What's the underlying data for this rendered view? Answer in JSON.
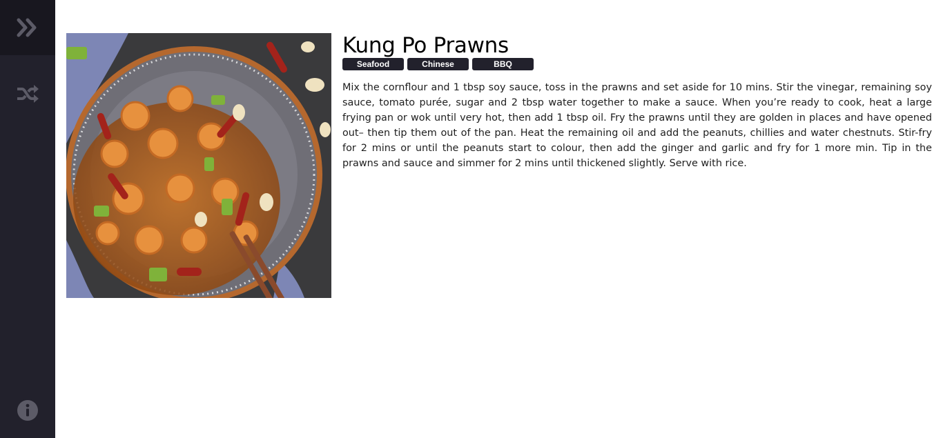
{
  "sidebar": {
    "expand_icon": "double-chevron-right-icon",
    "shuffle_icon": "shuffle-icon",
    "info_icon": "info-icon",
    "colors": {
      "background": "#22212c",
      "top_background": "#18171f",
      "icon": "#5c5b67"
    }
  },
  "recipe": {
    "title": "Kung Po Prawns",
    "tags": [
      "Seafood",
      "Chinese",
      "BBQ"
    ],
    "instructions": "Mix the cornflour and 1 tbsp soy sauce, toss in the prawns and set aside for 10 mins. Stir the vinegar, remaining soy sauce, tomato purée, sugar and 2 tbsp water together to make a sauce. When you’re ready to cook, heat a large frying pan or wok until very hot, then add 1 tbsp oil. Fry the prawns until they are golden in places and have opened out– then tip them out of the pan. Heat the remaining oil and add the peanuts, chillies and water chestnuts. Stir-fry for 2 mins or until the peanuts start to colour, then add the ginger and garlic and fry for 1 more min. Tip in the prawns and sauce and simmer for 2 mins until thickened slightly. Serve with rice."
  }
}
